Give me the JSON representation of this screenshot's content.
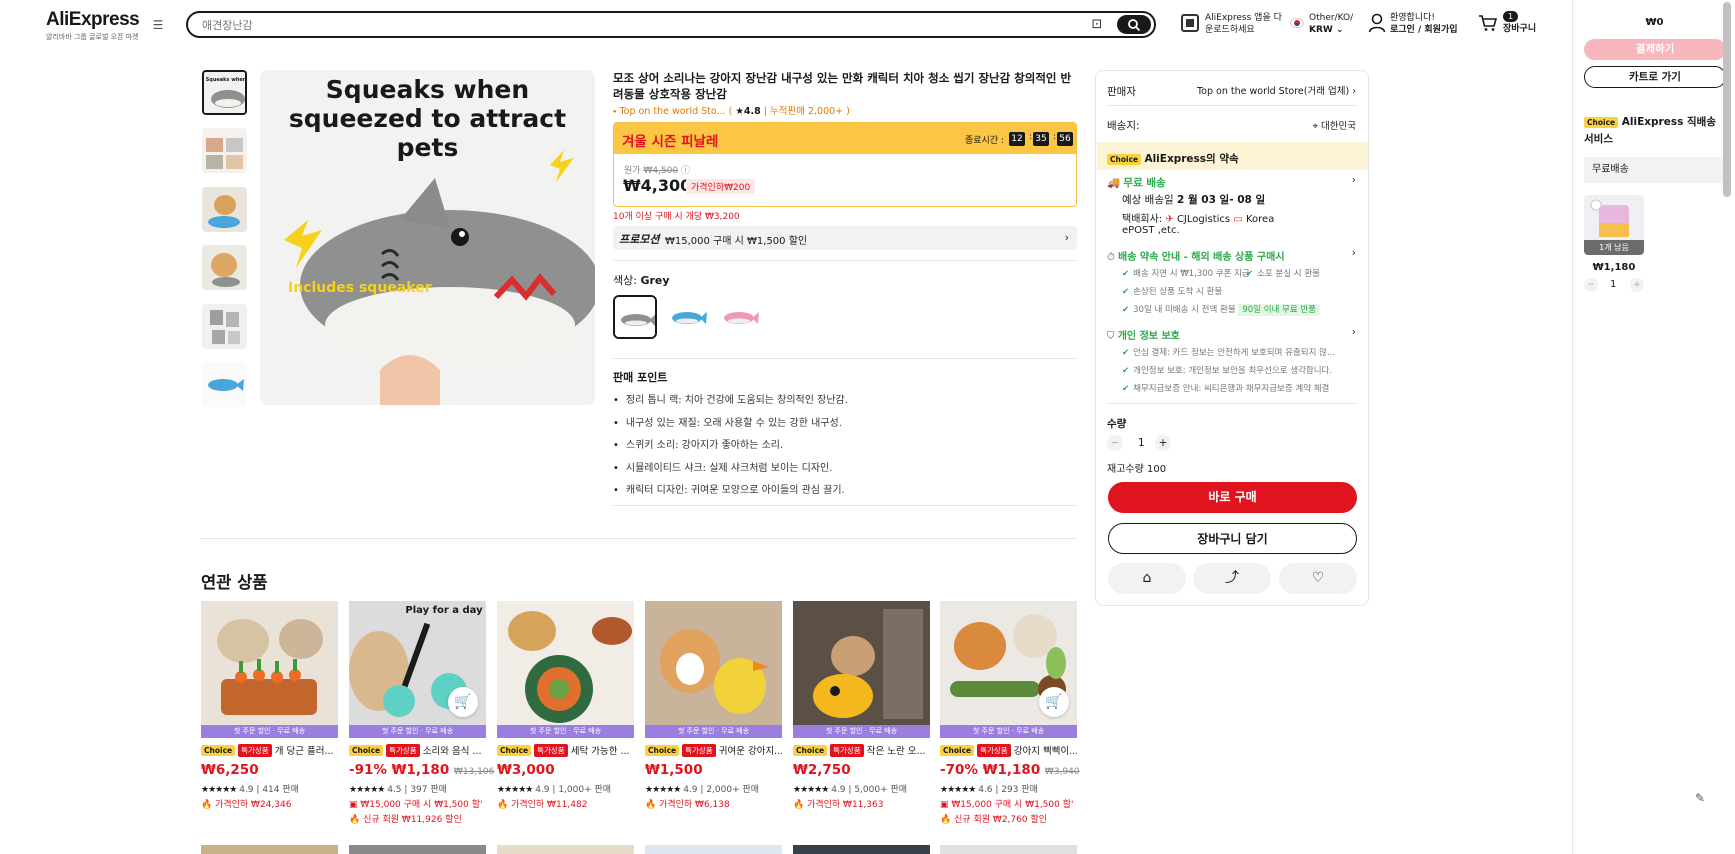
{
  "header": {
    "logo": "AliExpress",
    "logo_sub": "알리바바 그룹 글로벌 오픈 마켓",
    "search_placeholder": "애견장난감",
    "app_promo_line1": "AliExpress 앱을 다",
    "app_promo_line2": "운로드하세요",
    "locale_line1": "Other/KO/",
    "locale_line2": "KRW",
    "user_line1": "환영합니다!",
    "user_line2": "로그인 / 회원가입",
    "cart_count": "1",
    "cart_label": "장바구니"
  },
  "gallery": {
    "main_caption": "Squeaks when squeezed to attract pets",
    "main_sub": "Includes squeaker"
  },
  "product": {
    "title": "모조 상어 소리나는 강아지 장난감 내구성 있는 만화 캐릭터 치아 청소 씹기 장난감 창의적인 반려동물 상호작용 장난감",
    "store": "Top on the world Sto...",
    "rating": "4.8",
    "sold": "누적판매 2,000+",
    "sale_title": "겨울 시즌 피날레",
    "timer_label": "종료시간 :",
    "timer": [
      "12",
      "35",
      "56"
    ],
    "orig_label": "원가",
    "orig_price": "₩4,500",
    "price": "₩4,300",
    "price_drop": "가격인하₩200",
    "bulk": "10개 이상 구매 시 개당 ₩3,200",
    "promo_label": "프로모션",
    "promo_text": "₩15,000 구매 시 ₩1,500 할인",
    "color_label": "색상:",
    "color_value": "Grey",
    "points_title": "판매 포인트",
    "points": [
      "정리 톱니 랙: 치아 건강에 도움되는 창의적인 장난감.",
      "내구성 있는 재질: 오래 사용할 수 있는 강한 내구성.",
      "스퀴키 소리: 강아지가 좋아하는 소리.",
      "시뮬레이티드 샤크: 실제 샤크처럼 보이는 디자인.",
      "캐릭터 디자인: 귀여운 모양으로 아이들의 관심 끌기."
    ]
  },
  "related": {
    "title": "연관 상품",
    "band": "첫 주문 할인 · 무료 배송",
    "choice": "Choice",
    "deal": "특가상품",
    "items": [
      {
        "name": "개 당근 플러...",
        "price": "₩6,250",
        "discount": "",
        "old": "",
        "rating": "4.9",
        "sold": "414 판매",
        "extra1": "가격인하 ₩24,346",
        "extra2": ""
      },
      {
        "name": "소리와 음식 ...",
        "price": "₩1,180",
        "discount": "-91%",
        "old": "₩13,106",
        "rating": "4.5",
        "sold": "397 판매",
        "extra1": "₩15,000 구매 시 ₩1,500 할'",
        "extra2": "신규 회원 ₩11,926 할인"
      },
      {
        "name": "세탁 가능한 ...",
        "price": "₩3,000",
        "discount": "",
        "old": "",
        "rating": "4.9",
        "sold": "1,000+ 판매",
        "extra1": "가격인하 ₩11,482",
        "extra2": ""
      },
      {
        "name": "귀여운 강아지...",
        "price": "₩1,500",
        "discount": "",
        "old": "",
        "rating": "4.9",
        "sold": "2,000+ 판매",
        "extra1": "가격인하 ₩6,138",
        "extra2": ""
      },
      {
        "name": "작은 노란 오...",
        "price": "₩2,750",
        "discount": "",
        "old": "",
        "rating": "4.9",
        "sold": "5,000+ 판매",
        "extra1": "가격인하 ₩11,363",
        "extra2": ""
      },
      {
        "name": "강아지 삑삑이...",
        "price": "₩1,180",
        "discount": "-70%",
        "old": "₩3,940",
        "rating": "4.6",
        "sold": "293 판매",
        "extra1": "₩15,000 구매 시 ₩1,500 할'",
        "extra2": "신규 회원 ₩2,760 할인"
      }
    ]
  },
  "panel": {
    "seller_label": "판매자",
    "seller_value": "Top on the world Store(거래 업체)",
    "ship_to_label": "배송지:",
    "ship_to_value": "대한민국",
    "choice": "Choice",
    "promise": "AliExpress의 약속",
    "free_ship": "무료 배송",
    "eta_prefix": "예상 배송일",
    "eta": "2 월 03 일- 08 일",
    "carrier_label": "택배회사:",
    "carrier_1": "CJLogistics",
    "carrier_2": "Korea",
    "carrier_3": "ePOST ,etc.",
    "promise2": "배송 약속 안내 - 해외 배송 상품 구매시",
    "p2_items": [
      "배송 지연 시 ₩1,300 쿠폰 지급",
      "소포 분실 시 환불",
      "손상된 상품 도착 시 환불",
      "30일 내 미배송 시 전액 환불"
    ],
    "p2_badge": "90일 이내 무료 반품",
    "privacy": "개인 정보 보호",
    "privacy_items": [
      "안심 결제: 카드 정보는 안전하게 보호되며 유출되지 않...",
      "개인정보 보호: 개인정보 보안을 최우선으로 생각합니다.",
      "채무지급보증 안내: 씨티은행과 채무지급보증 계약 체결"
    ],
    "qty_label": "수량",
    "qty": "1",
    "stock": "재고수량 100",
    "buy_now": "바로 구매",
    "add_cart": "장바구니 담기"
  },
  "side": {
    "total": "₩0",
    "checkout": "결제하기",
    "go_cart": "카트로 가기",
    "choice": "Choice",
    "service": "AliExpress 직배송 서비스",
    "free_ship": "무료배송",
    "left": "1개 남음",
    "price": "₩1,180",
    "qty": "1"
  },
  "colors": {
    "accent": "#e0141e",
    "sale_yellow": "#fcc645",
    "choice_yellow": "#fcd23c",
    "green": "#2aa84a",
    "band_purple": "#9b7fe0"
  }
}
